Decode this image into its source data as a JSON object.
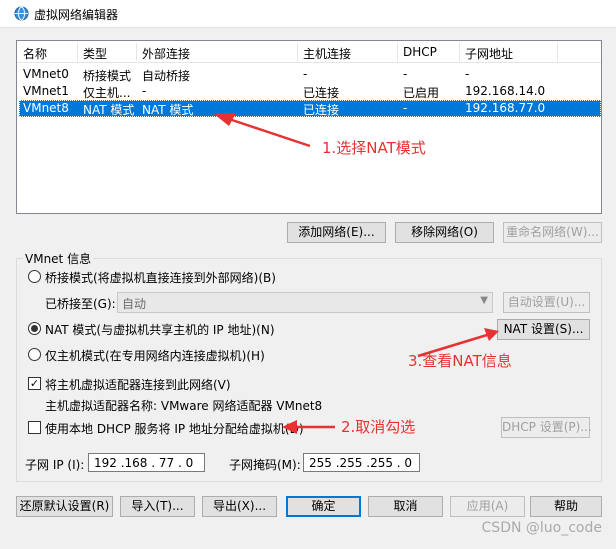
{
  "window": {
    "title": "虚拟网络编辑器"
  },
  "table": {
    "headers": [
      "名称",
      "类型",
      "外部连接",
      "主机连接",
      "DHCP",
      "子网地址"
    ],
    "rows": [
      [
        "VMnet0",
        "桥接模式",
        "自动桥接",
        "-",
        "-",
        "-"
      ],
      [
        "VMnet1",
        "仅主机...",
        "-",
        "已连接",
        "已启用",
        "192.168.14.0"
      ],
      [
        "VMnet8",
        "NAT 模式",
        "NAT 模式",
        "已连接",
        "-",
        "192.168.77.0"
      ]
    ],
    "selected_row": 2
  },
  "list_buttons": {
    "add": "添加网络(E)...",
    "remove": "移除网络(O)",
    "rename": "重命名网络(W)..."
  },
  "vmnet_info": {
    "title": "VMnet 信息",
    "bridge_mode": "桥接模式(将虚拟机直接连接到外部网络)(B)",
    "bridged_to_label": "已桥接至(G):",
    "bridged_to_value": "自动",
    "auto_settings": "自动设置(U)...",
    "nat_mode": "NAT 模式(与虚拟机共享主机的 IP 地址)(N)",
    "nat_settings": "NAT 设置(S)...",
    "host_only": "仅主机模式(在专用网络内连接虚拟机)(H)",
    "connect_adapter": "将主机虚拟适配器连接到此网络(V)",
    "adapter_name": "主机虚拟适配器名称: VMware 网络适配器 VMnet8",
    "use_dhcp": "使用本地 DHCP 服务将 IP 地址分配给虚拟机(D)",
    "dhcp_settings": "DHCP 设置(P)...",
    "subnet_ip_label": "子网 IP (I):",
    "subnet_ip": "192 .168 . 77 . 0",
    "subnet_mask_label": "子网掩码(M):",
    "subnet_mask": "255 .255 .255 . 0"
  },
  "footer": {
    "restore": "还原默认设置(R)",
    "import": "导入(T)...",
    "export": "导出(X)...",
    "ok": "确定",
    "cancel": "取消",
    "apply": "应用(A)",
    "help": "帮助"
  },
  "annotations": {
    "a1": "1.选择NAT模式",
    "a2": "2.取消勾选",
    "a3": "3.查看NAT信息"
  },
  "watermark": "CSDN @luo_code",
  "colors": {
    "selection": "#0078d7",
    "annotation": "#e83232"
  }
}
